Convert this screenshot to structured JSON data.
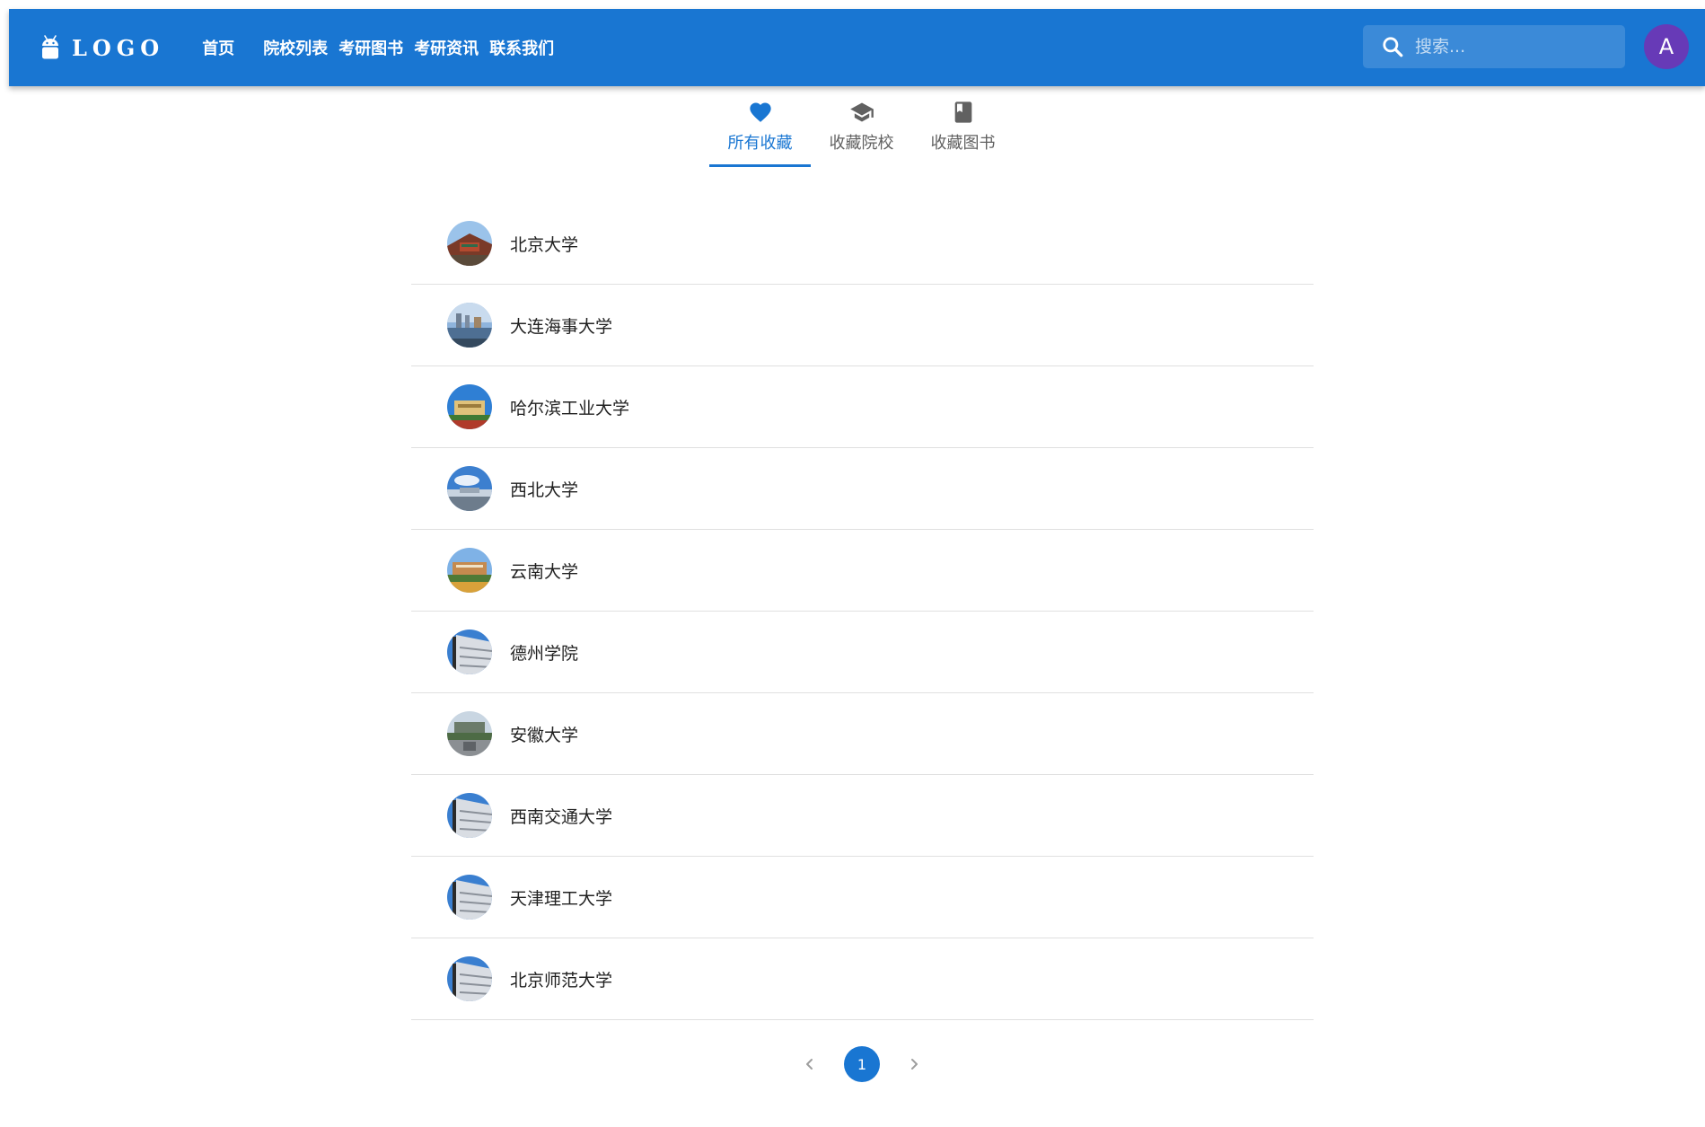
{
  "header": {
    "logo_text": "LOGO",
    "nav": [
      "首页",
      "院校列表",
      "考研图书",
      "考研资讯",
      "联系我们"
    ],
    "search_placeholder": "搜索...",
    "avatar_letter": "A",
    "brand_color": "#1976d2",
    "avatar_color": "#673ab7"
  },
  "tabs": [
    {
      "label": "所有收藏",
      "icon": "heart-icon",
      "active": true
    },
    {
      "label": "收藏院校",
      "icon": "graduation-cap-icon",
      "active": false
    },
    {
      "label": "收藏图书",
      "icon": "book-icon",
      "active": false
    }
  ],
  "favorites": [
    {
      "name": "北京大学",
      "thumbnail": "campus-gate-photo"
    },
    {
      "name": "大连海事大学",
      "thumbnail": "campus-lake-photo"
    },
    {
      "name": "哈尔滨工业大学",
      "thumbnail": "campus-building-photo"
    },
    {
      "name": "西北大学",
      "thumbnail": "campus-sky-photo"
    },
    {
      "name": "云南大学",
      "thumbnail": "campus-building-photo"
    },
    {
      "name": "德州学院",
      "thumbnail": "campus-default-photo"
    },
    {
      "name": "安徽大学",
      "thumbnail": "campus-square-photo"
    },
    {
      "name": "西南交通大学",
      "thumbnail": "campus-default-photo"
    },
    {
      "name": "天津理工大学",
      "thumbnail": "campus-default-photo"
    },
    {
      "name": "北京师范大学",
      "thumbnail": "campus-default-photo"
    }
  ],
  "pagination": {
    "current_page": "1"
  }
}
